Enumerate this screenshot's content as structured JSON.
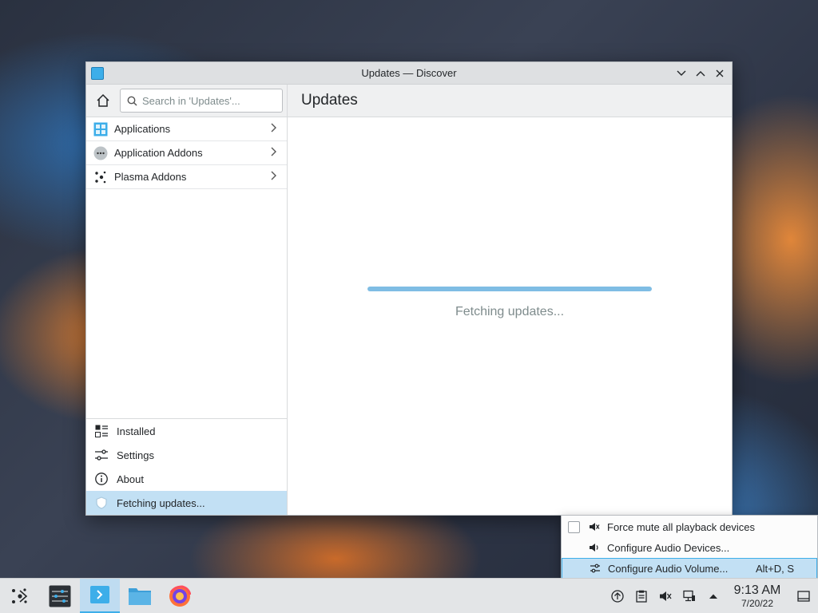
{
  "window": {
    "title": "Updates — Discover",
    "controls": [
      "minimize",
      "maximize",
      "close"
    ]
  },
  "sidebar": {
    "search_placeholder": "Search in 'Updates'...",
    "categories": [
      {
        "label": "Applications",
        "icon": "applications-icon"
      },
      {
        "label": "Application Addons",
        "icon": "addons-icon"
      },
      {
        "label": "Plasma Addons",
        "icon": "plasma-icon"
      }
    ],
    "bottom_nav": [
      {
        "label": "Installed",
        "icon": "installed-icon"
      },
      {
        "label": "Settings",
        "icon": "settings-icon"
      },
      {
        "label": "About",
        "icon": "info-icon"
      },
      {
        "label": "Fetching updates...",
        "icon": "shield-icon",
        "active": true
      }
    ]
  },
  "main": {
    "heading": "Updates",
    "status_text": "Fetching updates...",
    "progress": 1.0
  },
  "context_menu": {
    "items": [
      {
        "label": "Force mute all playback devices",
        "checkbox": true,
        "checked": false
      },
      {
        "label": "Configure Audio Devices...",
        "shortcut": ""
      },
      {
        "label": "Configure Audio Volume...",
        "shortcut": "Alt+D, S",
        "highlighted": true
      }
    ]
  },
  "taskbar": {
    "apps": [
      "app-launcher",
      "system-settings",
      "discover",
      "dolphin",
      "firefox"
    ],
    "time": "9:13 AM",
    "date": "7/20/22"
  },
  "colors": {
    "accent": "#3daee9",
    "selection": "#c2e0f4"
  }
}
